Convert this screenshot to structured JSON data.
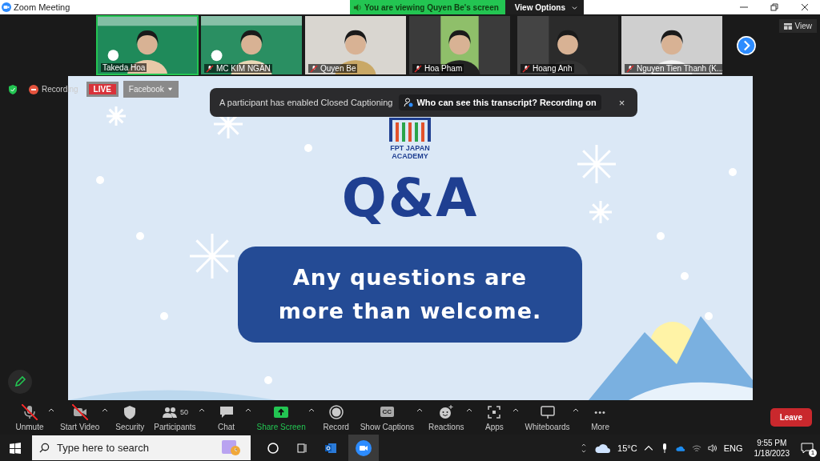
{
  "window": {
    "title": "Zoom Meeting"
  },
  "share_banner": {
    "text": "You are viewing Quyen Be's screen",
    "menu": "View Options"
  },
  "participants": [
    {
      "name": "Takeda Hoa",
      "muted": false,
      "speaking": true
    },
    {
      "name": "MC KIM NGÂN",
      "muted": true,
      "speaking": false
    },
    {
      "name": "Quyen Be",
      "muted": true,
      "speaking": false
    },
    {
      "name": "Hoa Pham",
      "muted": true,
      "speaking": false
    },
    {
      "name": "Hoang Anh",
      "muted": true,
      "speaking": false
    },
    {
      "name": "Nguyen Tien Thanh (K...",
      "muted": true,
      "speaking": false
    }
  ],
  "view_button": "View",
  "status": {
    "recording": "Recording",
    "live": "LIVE",
    "stream": "Facebook"
  },
  "notice": {
    "text": "A participant has enabled Closed Captioning",
    "link": "Who can see this transcript? Recording on",
    "close": "×"
  },
  "slide": {
    "logo_lines": [
      "FPT JAPAN",
      "ACADEMY"
    ],
    "title": "Q&A",
    "message": "Any questions are more than welcome."
  },
  "toolbar": [
    {
      "kind": "mic",
      "label": "Unmute",
      "off": true,
      "caret": true
    },
    {
      "kind": "video",
      "label": "Start Video",
      "off": true,
      "caret": true
    },
    {
      "kind": "shield",
      "label": "Security",
      "off": false,
      "caret": false
    },
    {
      "kind": "people",
      "label": "Participants",
      "count": "50",
      "off": false,
      "caret": true
    },
    {
      "kind": "chat",
      "label": "Chat",
      "off": false,
      "caret": true
    },
    {
      "kind": "share",
      "label": "Share Screen",
      "off": false,
      "caret": true
    },
    {
      "kind": "record",
      "label": "Record",
      "off": false,
      "caret": false
    },
    {
      "kind": "cc",
      "label": "Show Captions",
      "badge": "CC",
      "off": false,
      "caret": true
    },
    {
      "kind": "reactions",
      "label": "Reactions",
      "off": false,
      "caret": true
    },
    {
      "kind": "apps",
      "label": "Apps",
      "off": false,
      "caret": true
    },
    {
      "kind": "whiteboard",
      "label": "Whiteboards",
      "off": false,
      "caret": true
    },
    {
      "kind": "more",
      "label": "More",
      "icon": "•••",
      "off": false,
      "caret": false
    }
  ],
  "leave": "Leave",
  "taskbar": {
    "search_placeholder": "Type here to search",
    "temperature": "15°C",
    "language": "ENG",
    "time": "9:55 PM",
    "date": "1/18/2023",
    "notifications": "1"
  }
}
